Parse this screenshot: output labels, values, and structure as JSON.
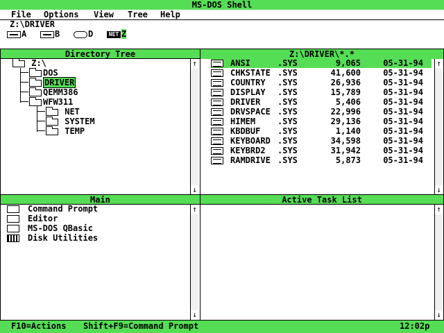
{
  "window": {
    "title": "MS-DOS Shell"
  },
  "menu": [
    "File",
    "Options",
    "View",
    "Tree",
    "Help"
  ],
  "current_path": "Z:\\DRIVER",
  "drives": [
    {
      "letter": "A",
      "icon": "floppy-icon"
    },
    {
      "letter": "B",
      "icon": "floppy-icon"
    },
    {
      "letter": "D",
      "icon": "cd-icon"
    },
    {
      "letter": "Z",
      "icon": "network-drive-icon",
      "label": "NET",
      "selected": true
    }
  ],
  "directory_tree": {
    "title": "Directory Tree",
    "root": "Z:\\",
    "items": [
      "DOS",
      "DRIVER",
      "QEMM386",
      "WFW311",
      "NET",
      "SYSTEM",
      "TEMP"
    ],
    "selected": "DRIVER"
  },
  "file_list": {
    "title": "Z:\\DRIVER\\*.*",
    "files": [
      {
        "name": "ANSI",
        "ext": ".SYS",
        "size": "9,065",
        "date": "05-31-94"
      },
      {
        "name": "CHKSTATE",
        "ext": ".SYS",
        "size": "41,600",
        "date": "05-31-94"
      },
      {
        "name": "COUNTRY",
        "ext": ".SYS",
        "size": "26,936",
        "date": "05-31-94"
      },
      {
        "name": "DISPLAY",
        "ext": ".SYS",
        "size": "15,789",
        "date": "05-31-94"
      },
      {
        "name": "DRIVER",
        "ext": ".SYS",
        "size": "5,406",
        "date": "05-31-94"
      },
      {
        "name": "DRVSPACE",
        "ext": ".SYS",
        "size": "22,996",
        "date": "05-31-94"
      },
      {
        "name": "HIMEM",
        "ext": ".SYS",
        "size": "29,136",
        "date": "05-31-94"
      },
      {
        "name": "KBDBUF",
        "ext": ".SYS",
        "size": "1,140",
        "date": "05-31-94"
      },
      {
        "name": "KEYBOARD",
        "ext": ".SYS",
        "size": "34,598",
        "date": "05-31-94"
      },
      {
        "name": "KEYBRD2",
        "ext": ".SYS",
        "size": "31,942",
        "date": "05-31-94"
      },
      {
        "name": "RAMDRIVE",
        "ext": ".SYS",
        "size": "5,873",
        "date": "05-31-94"
      }
    ]
  },
  "main_panel": {
    "title": "Main",
    "items": [
      {
        "label": "Command Prompt",
        "icon": "program-icon"
      },
      {
        "label": "Editor",
        "icon": "program-icon"
      },
      {
        "label": "MS-DOS QBasic",
        "icon": "program-icon"
      },
      {
        "label": "Disk Utilities",
        "icon": "group-icon"
      }
    ]
  },
  "task_panel": {
    "title": "Active Task List"
  },
  "status": {
    "actions": "F10=Actions",
    "command": "Shift+F9=Command Prompt",
    "time": "12:02p"
  },
  "scroll_icons": {
    "up": "↑",
    "down": "↓"
  },
  "colors": {
    "accent": "#55dd55",
    "text": "#000000",
    "background": "#ffffff"
  }
}
